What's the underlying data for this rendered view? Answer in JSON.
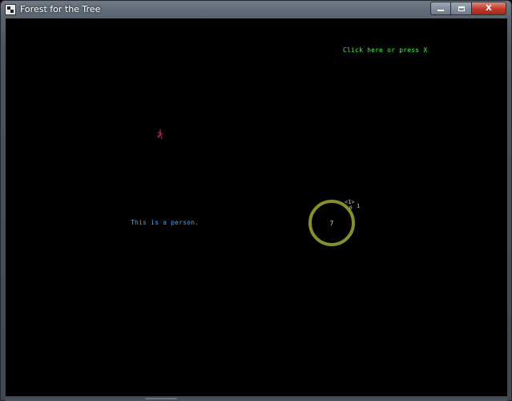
{
  "window": {
    "title": "Forest for the Tree",
    "controls": {
      "minimize_icon": "minimize-icon",
      "maximize_icon": "maximize-icon",
      "close_label": "X"
    }
  },
  "game": {
    "hint_text": "Click here or press X",
    "caption_text": "This is a person.",
    "ring": {
      "value": "7",
      "color": "#878f2c"
    },
    "marker": {
      "label": "<1>",
      "sub_label": "0",
      "count": "1"
    },
    "colors": {
      "hint": "#40ff40",
      "caption": "#3da7ff",
      "glyph": "#b0204a",
      "background": "#000000"
    }
  }
}
